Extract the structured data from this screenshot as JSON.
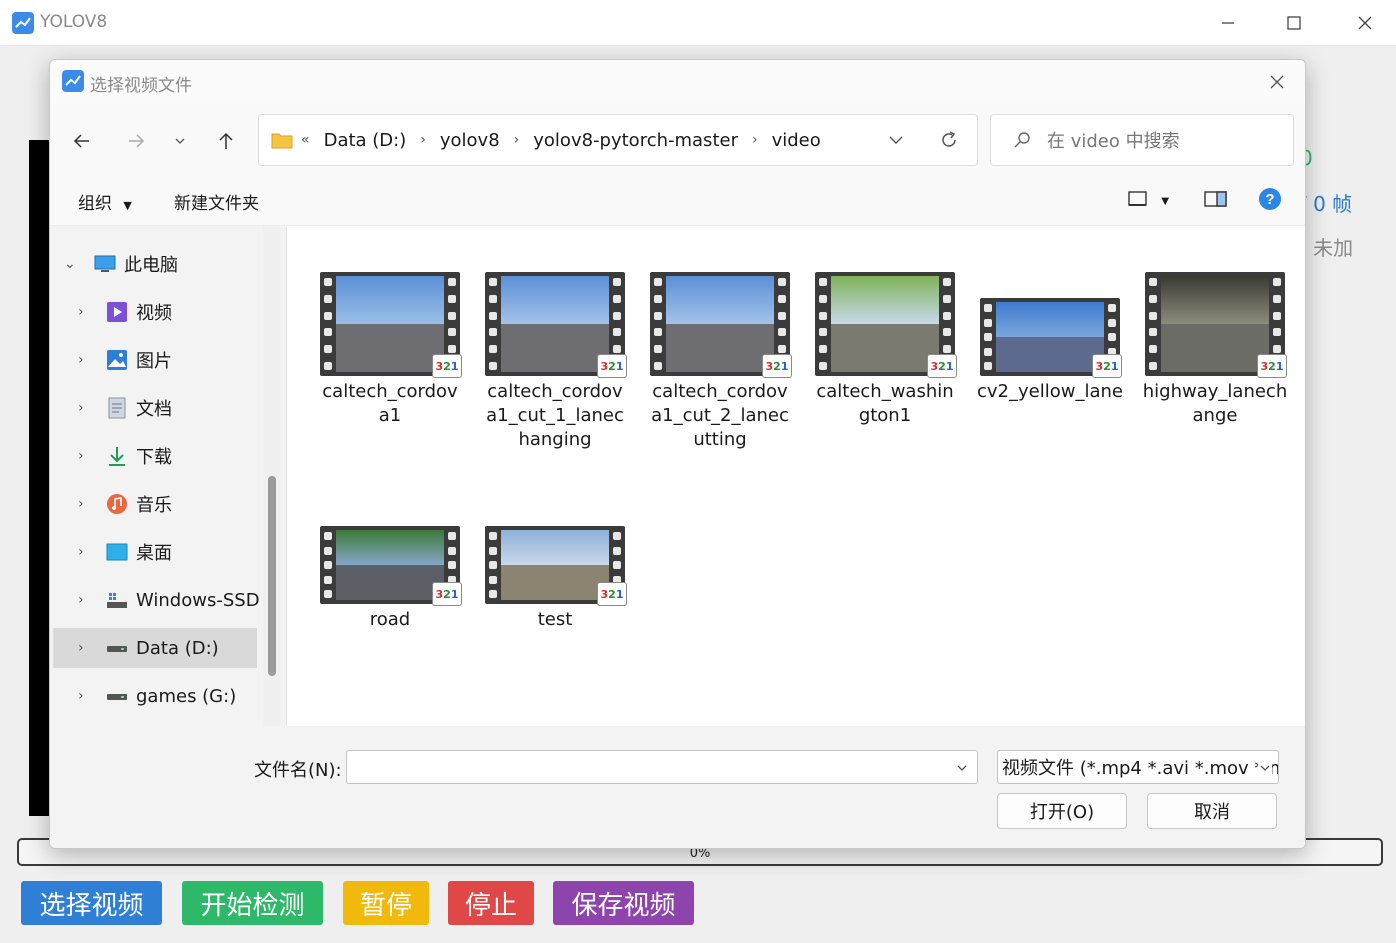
{
  "app": {
    "title": "YOLOV8",
    "right_info": [
      "0",
      "/ 0 帧",
      ": 未加"
    ]
  },
  "progress": {
    "text": "0%",
    "value": 0
  },
  "buttons": [
    {
      "label": "选择视频",
      "color": "#2f7fd6"
    },
    {
      "label": "开始检测",
      "color": "#2eb86a"
    },
    {
      "label": "暂停",
      "color": "#f0b90b"
    },
    {
      "label": "停止",
      "color": "#e04848"
    },
    {
      "label": "保存视频",
      "color": "#8e44ad"
    }
  ],
  "dialog": {
    "title": "选择视频文件",
    "address": {
      "overflow": "«",
      "segments": [
        "Data (D:)",
        "yolov8",
        "yolov8-pytorch-master",
        "video"
      ]
    },
    "search_placeholder": "在 video 中搜索",
    "commands": {
      "organize": "组织",
      "new_folder": "新建文件夹"
    },
    "nav": [
      {
        "label": "此电脑",
        "icon": "computer-icon",
        "expanded": true
      },
      {
        "label": "视频",
        "icon": "videos-icon"
      },
      {
        "label": "图片",
        "icon": "pictures-icon"
      },
      {
        "label": "文档",
        "icon": "documents-icon"
      },
      {
        "label": "下载",
        "icon": "download-icon"
      },
      {
        "label": "音乐",
        "icon": "music-icon"
      },
      {
        "label": "桌面",
        "icon": "desktop-icon"
      },
      {
        "label": "Windows-SSD",
        "icon": "drive-icon"
      },
      {
        "label": "Data (D:)",
        "icon": "drive-icon",
        "selected": true
      },
      {
        "label": "games (G:)",
        "icon": "drive-icon"
      }
    ],
    "files": [
      {
        "name": "caltech_cordova1"
      },
      {
        "name": "caltech_cordova1_cut_1_lanechanging"
      },
      {
        "name": "caltech_cordova1_cut_2_lanecutting"
      },
      {
        "name": "caltech_washington1"
      },
      {
        "name": "cv2_yellow_lane"
      },
      {
        "name": "highway_lanechange"
      },
      {
        "name": "road"
      },
      {
        "name": "test"
      }
    ],
    "file_name_label": "文件名(N):",
    "file_name_value": "",
    "file_type": "视频文件 (*.mp4 *.avi *.mov *.m",
    "open_button": "打开(O)",
    "cancel_button": "取消"
  }
}
